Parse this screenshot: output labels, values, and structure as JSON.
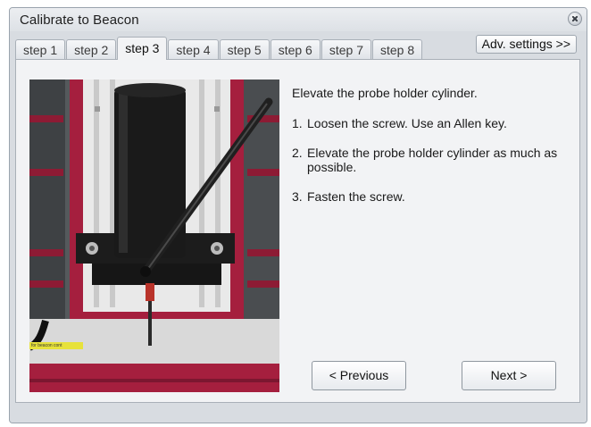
{
  "window": {
    "title": "Calibrate to Beacon"
  },
  "tabs": [
    {
      "label": "step 1",
      "active": false
    },
    {
      "label": "step 2",
      "active": false
    },
    {
      "label": "step 3",
      "active": true
    },
    {
      "label": "step 4",
      "active": false
    },
    {
      "label": "step 5",
      "active": false
    },
    {
      "label": "step 6",
      "active": false
    },
    {
      "label": "step 7",
      "active": false
    },
    {
      "label": "step 8",
      "active": false
    }
  ],
  "adv_settings_label": "Adv. settings >>",
  "instructions": {
    "intro": "Elevate the probe holder cylinder.",
    "steps": [
      {
        "num": "1.",
        "text": "Loosen the screw. Use an Allen key."
      },
      {
        "num": "2.",
        "text": "Elevate the probe holder cylinder as much as possible."
      },
      {
        "num": "3.",
        "text": "Fasten the screw."
      }
    ]
  },
  "photo_label_text": "for beacon cont",
  "buttons": {
    "previous": "< Previous",
    "next": "Next >"
  },
  "colors": {
    "frame_red": "#a51f3e",
    "cylinder_black": "#1a1a1a",
    "window_bg": "#d8dce1",
    "panel_bg": "#f2f3f5"
  }
}
